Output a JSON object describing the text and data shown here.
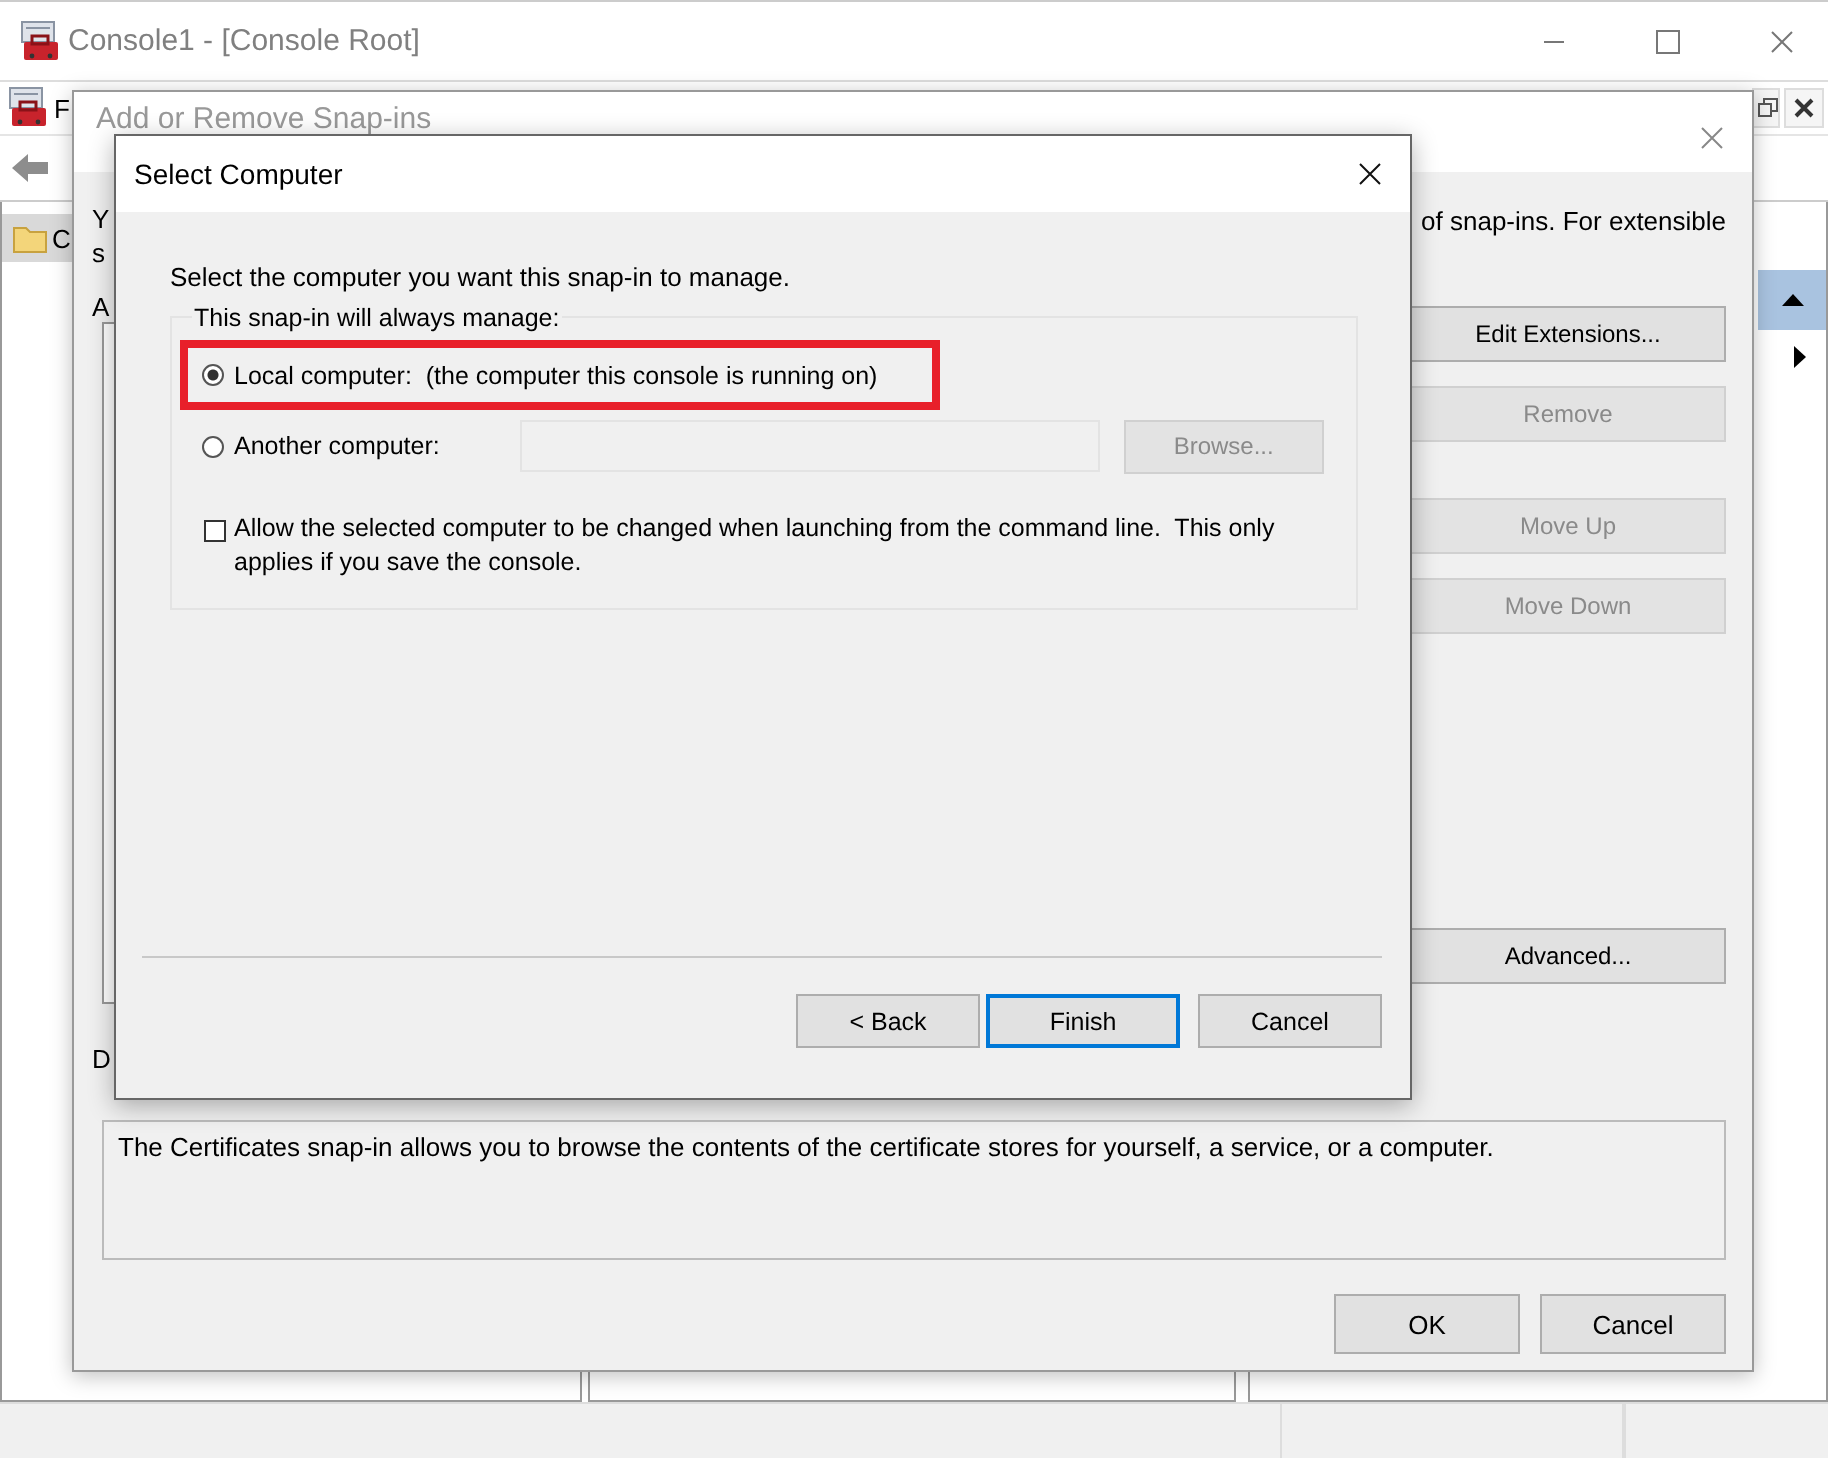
{
  "main_window": {
    "title": "Console1 - [Console Root]",
    "menu_fragment": "F",
    "tree_items": [
      {
        "label": "C",
        "selected": true
      }
    ]
  },
  "snapin_dialog": {
    "title": "Add or Remove Snap-ins",
    "intro_fragments": [
      "Y",
      "s"
    ],
    "intro_right": "of snap-ins. For extensible",
    "list_label_fragment": "A",
    "description_label_fragment": "D",
    "side_buttons": [
      {
        "label": "Edit Extensions...",
        "disabled": false
      },
      {
        "label": "Remove",
        "disabled": true
      },
      {
        "label": "Move Up",
        "disabled": true
      },
      {
        "label": "Move Down",
        "disabled": true
      },
      {
        "label": "Advanced...",
        "disabled": false
      }
    ],
    "description": "The Certificates snap-in allows you to browse the contents of the certificate stores for yourself, a service, or a computer.",
    "footer_buttons": [
      {
        "label": "OK"
      },
      {
        "label": "Cancel"
      }
    ]
  },
  "select_computer": {
    "title": "Select Computer",
    "prompt": "Select the computer you want this snap-in to manage.",
    "group_label": "This snap-in will always manage:",
    "options": [
      {
        "label": "Local computer:  (the computer this console is running on)",
        "selected": true,
        "highlighted": true
      },
      {
        "label": "Another computer:",
        "selected": false,
        "highlighted": false
      }
    ],
    "computer_field": {
      "disabled": true
    },
    "browse_button": {
      "label": "Browse...",
      "disabled": true
    },
    "checkbox": {
      "label": "Allow the selected computer to be changed when launching from the command line.  This only applies if you save the console.",
      "checked": false
    },
    "buttons": [
      {
        "label": "< Back",
        "default": false
      },
      {
        "label": "Finish",
        "default": true
      },
      {
        "label": "Cancel",
        "default": false
      }
    ]
  }
}
